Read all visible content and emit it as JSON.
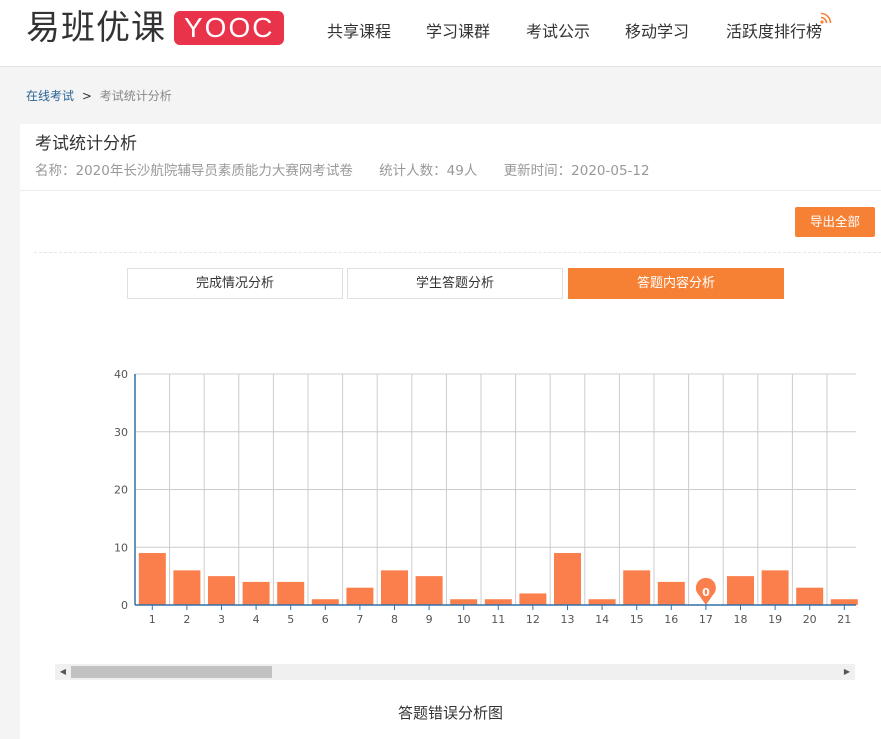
{
  "header": {
    "logo_text": "易班优课",
    "logo_badge": "YOOC",
    "nav": [
      {
        "label": "共享课程"
      },
      {
        "label": "学习课群"
      },
      {
        "label": "考试公示"
      },
      {
        "label": "移动学习"
      },
      {
        "label": "活跃度排行榜"
      }
    ],
    "rss_icon": "rss-icon"
  },
  "breadcrumb": {
    "root": "在线考试",
    "separator": ">",
    "current": "考试统计分析"
  },
  "panel": {
    "title": "考试统计分析",
    "meta": {
      "name": "名称：2020年长沙航院辅导员素质能力大赛网考试卷",
      "count": "统计人数：49人",
      "updated": "更新时间：2020-05-12"
    },
    "export_label": "导出全部",
    "tabs": [
      {
        "label": "完成情况分析",
        "active": false
      },
      {
        "label": "学生答题分析",
        "active": false
      },
      {
        "label": "答题内容分析",
        "active": true
      }
    ]
  },
  "colors": {
    "accent": "#f68135",
    "bar": "#fb7f4c",
    "axis": "#3071a9",
    "grid": "#cccccc"
  },
  "chart_data": {
    "type": "bar",
    "title": "答题错误分析图",
    "categories": [
      "1",
      "2",
      "3",
      "4",
      "5",
      "6",
      "7",
      "8",
      "9",
      "10",
      "11",
      "12",
      "13",
      "14",
      "15",
      "16",
      "17",
      "18",
      "19",
      "20",
      "21"
    ],
    "values": [
      9,
      6,
      5,
      4,
      4,
      1,
      3,
      6,
      5,
      1,
      1,
      2,
      9,
      1,
      6,
      4,
      0,
      5,
      6,
      3,
      1
    ],
    "ylim": [
      0,
      40
    ],
    "yticks": [
      0,
      10,
      20,
      30,
      40
    ],
    "marker": {
      "category": "17",
      "label": "0"
    },
    "grid": true
  },
  "scroll": {
    "left_arrow": "◀",
    "right_arrow": "▶"
  }
}
